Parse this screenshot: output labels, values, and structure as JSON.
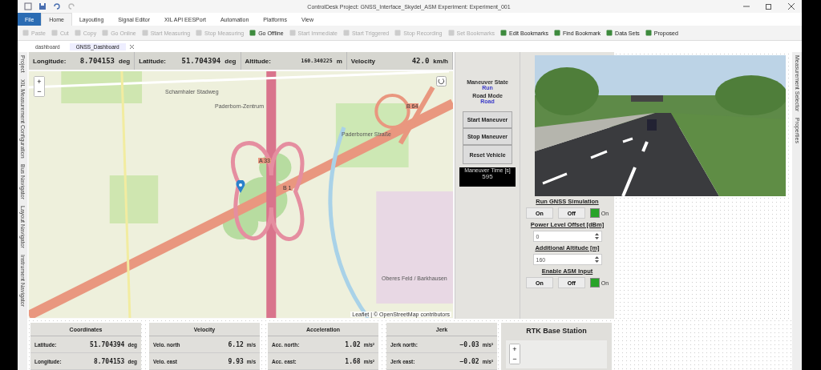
{
  "window": {
    "title": "ControlDesk Project: GNSS_Interface_Skydel_ASM Experiment: Experiment_001"
  },
  "ribbon_tabs": [
    {
      "label": "File",
      "selected": false,
      "kind": "file"
    },
    {
      "label": "Home",
      "selected": true,
      "kind": "tab"
    },
    {
      "label": "Layouting",
      "selected": false,
      "kind": "tab"
    },
    {
      "label": "Signal Editor",
      "selected": false,
      "kind": "tab"
    },
    {
      "label": "XIL API EESPort",
      "selected": false,
      "kind": "tab"
    },
    {
      "label": "Automation",
      "selected": false,
      "kind": "tab"
    },
    {
      "label": "Platforms",
      "selected": false,
      "kind": "tab"
    },
    {
      "label": "View",
      "selected": false,
      "kind": "tab"
    }
  ],
  "toolbar": [
    {
      "label": "Paste",
      "disabled": true
    },
    {
      "label": "Cut",
      "disabled": true
    },
    {
      "label": "Copy",
      "disabled": true
    },
    {
      "label": "Go Online",
      "disabled": true
    },
    {
      "label": "Start Measuring",
      "disabled": true
    },
    {
      "label": "Stop Measuring",
      "disabled": true
    },
    {
      "label": "Go Offline",
      "disabled": false
    },
    {
      "label": "Start Immediate",
      "disabled": true
    },
    {
      "label": "Start Triggered",
      "disabled": true
    },
    {
      "label": "Stop Recording",
      "disabled": true
    },
    {
      "label": "Set Bookmarks",
      "disabled": true
    },
    {
      "label": "Edit Bookmarks",
      "disabled": false
    },
    {
      "label": "Find Bookmark",
      "disabled": false
    },
    {
      "label": "Data Sets",
      "disabled": false
    },
    {
      "label": "Proposed",
      "disabled": false
    }
  ],
  "doc_tabs": [
    {
      "label": "dashboard",
      "selected": false
    },
    {
      "label": "GNSS_Dashboard",
      "selected": true
    }
  ],
  "left_panels": [
    "Project",
    "XIL Measurement Configuration",
    "Bus Navigator",
    "Layout Navigator",
    "Instrument Navigator"
  ],
  "right_panels": [
    "Measurement Selector",
    "Properties"
  ],
  "readouts": [
    {
      "label": "Longitude:",
      "value": "8.704153",
      "unit": "deg"
    },
    {
      "label": "Latitude:",
      "value": "51.704394",
      "unit": "deg"
    },
    {
      "label": "Altitude:",
      "value": "160.340225",
      "unit": "m"
    },
    {
      "label": "Velocity",
      "value": "42.0",
      "unit": "km/h"
    }
  ],
  "map": {
    "zoom_in": "+",
    "zoom_out": "−",
    "street_labels": [
      "Schamhaler Stadweg",
      "Paderborn-Zentrum",
      "Paderborner Straße",
      "A 33",
      "B 1",
      "B 64",
      "Oberes Feld / Barkhausen"
    ],
    "attribution": "Leaflet | © OpenStreetMap contributors"
  },
  "maneuver": {
    "state_label": "Maneuver State",
    "state": "Run",
    "mode_label": "Road Mode",
    "mode": "Road",
    "buttons": [
      "Start Maneuver",
      "Stop Maneuver",
      "Reset Vehicle"
    ],
    "time_label": "Maneuver Time [s]",
    "time": "595"
  },
  "gnss": {
    "title": "Run GNSS Simulation",
    "on": "On",
    "off": "Off",
    "led_on": true,
    "led_label": "On"
  },
  "power": {
    "title": "Power Level Offset [dBm]",
    "value": "0"
  },
  "altitude": {
    "title": "Additional Altitude [m]",
    "value": "160"
  },
  "asm": {
    "title": "Enable ASM Input",
    "on": "On",
    "off": "Off",
    "led_on": true,
    "led_label": "On"
  },
  "cards": [
    {
      "title": "Coordinates",
      "rows": [
        {
          "label": "Latitude:",
          "value": "51.704394",
          "unit": "deg"
        },
        {
          "label": "Longitude:",
          "value": "8.704153",
          "unit": "deg"
        }
      ]
    },
    {
      "title": "Velocity",
      "rows": [
        {
          "label": "Velo. north",
          "value": "6.12",
          "unit": "m/s"
        },
        {
          "label": "Velo. east",
          "value": "9.93",
          "unit": "m/s"
        }
      ]
    },
    {
      "title": "Acceleration",
      "rows": [
        {
          "label": "Acc. north:",
          "value": "1.02",
          "unit": "m/s²"
        },
        {
          "label": "Acc. east:",
          "value": "1.68",
          "unit": "m/s²"
        }
      ]
    },
    {
      "title": "Jerk",
      "rows": [
        {
          "label": "Jerk north:",
          "value": "−0.03",
          "unit": "m/s³"
        },
        {
          "label": "Jerk east:",
          "value": "−0.02",
          "unit": "m/s³"
        }
      ]
    }
  ],
  "rtk": {
    "title": "RTK Base Station",
    "zoom_in": "+",
    "zoom_out": "−"
  }
}
